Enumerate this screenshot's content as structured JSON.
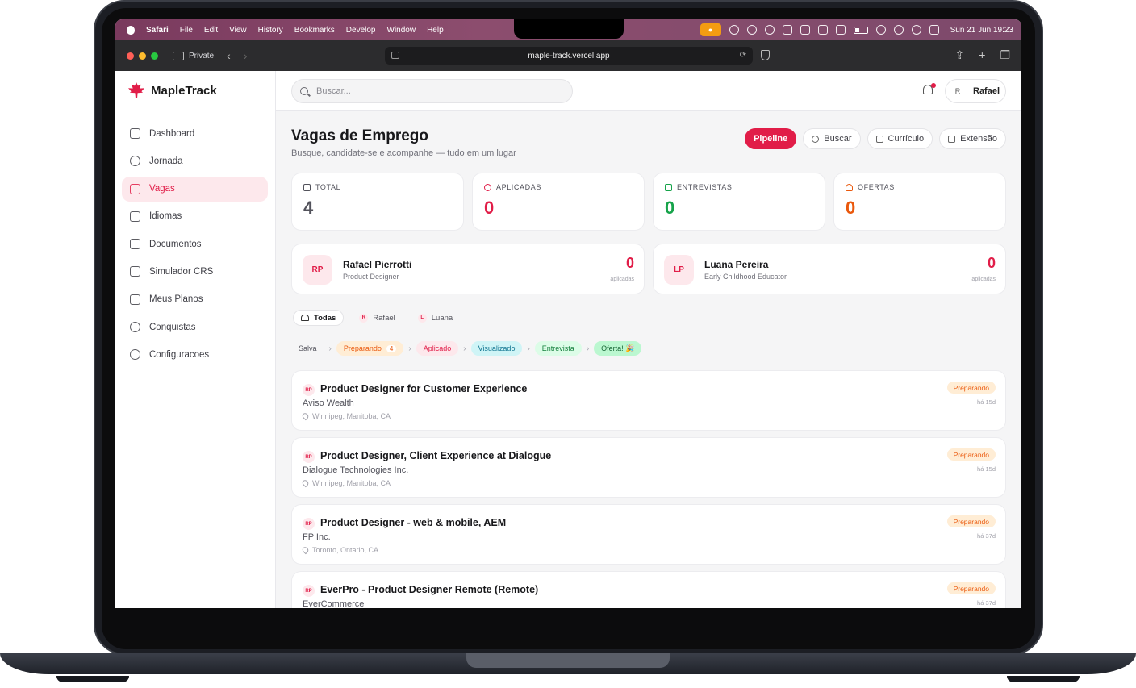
{
  "menubar": {
    "app": "Safari",
    "items": [
      "File",
      "Edit",
      "View",
      "History",
      "Bookmarks",
      "Develop",
      "Window",
      "Help"
    ],
    "clock": "Sun 21 Jun  19:23"
  },
  "browser": {
    "private_label": "Private",
    "url": "maple-track.vercel.app"
  },
  "brand": {
    "name": "MapleTrack",
    "color": "#e11d48"
  },
  "nav": {
    "items": [
      {
        "label": "Dashboard",
        "icon": "dashboard-icon"
      },
      {
        "label": "Jornada",
        "icon": "route-icon"
      },
      {
        "label": "Vagas",
        "icon": "briefcase-icon",
        "active": true
      },
      {
        "label": "Idiomas",
        "icon": "translate-icon"
      },
      {
        "label": "Documentos",
        "icon": "document-icon"
      },
      {
        "label": "Simulador CRS",
        "icon": "calculator-icon"
      },
      {
        "label": "Meus Planos",
        "icon": "map-icon"
      },
      {
        "label": "Conquistas",
        "icon": "trophy-icon"
      },
      {
        "label": "Configuracoes",
        "icon": "gear-icon"
      }
    ]
  },
  "topbar": {
    "search_placeholder": "Buscar...",
    "user_initial": "R",
    "user_name": "Rafael"
  },
  "page": {
    "title": "Vagas de Emprego",
    "subtitle": "Busque, candidate-se e acompanhe — tudo em um lugar",
    "actions": [
      "Pipeline",
      "Buscar",
      "Currículo",
      "Extensão"
    ]
  },
  "stats": [
    {
      "label": "TOTAL",
      "value": "4",
      "color": "#52525b"
    },
    {
      "label": "APLICADAS",
      "value": "0",
      "color": "#e11d48"
    },
    {
      "label": "ENTREVISTAS",
      "value": "0",
      "color": "#16a34a"
    },
    {
      "label": "OFERTAS",
      "value": "0",
      "color": "#ea580c"
    }
  ],
  "people": [
    {
      "initials": "RP",
      "name": "Rafael Pierrotti",
      "role": "Product Designer",
      "count": "0",
      "count_label": "aplicadas"
    },
    {
      "initials": "LP",
      "name": "Luana Pereira",
      "role": "Early Childhood Educator",
      "count": "0",
      "count_label": "aplicadas"
    }
  ],
  "filters": {
    "all": "Todas",
    "people": [
      {
        "initial": "R",
        "name": "Rafael"
      },
      {
        "initial": "L",
        "name": "Luana"
      }
    ]
  },
  "stages": [
    {
      "label": "Salva"
    },
    {
      "label": "Preparando",
      "count": "4",
      "bg": "#ffedd5",
      "fg": "#ea580c"
    },
    {
      "label": "Aplicado",
      "bg": "#fde8ec",
      "fg": "#e11d48"
    },
    {
      "label": "Visualizado",
      "bg": "#cff4f6",
      "fg": "#0e7490"
    },
    {
      "label": "Entrevista",
      "bg": "#dcfce7",
      "fg": "#15803d"
    },
    {
      "label": "Oferta! 🎉",
      "bg": "#bbf7d0",
      "fg": "#166534"
    }
  ],
  "jobs": [
    {
      "badge": "RP",
      "title": "Product Designer for Customer Experience",
      "company": "Aviso Wealth",
      "location": "Winnipeg, Manitoba, CA",
      "status": "Preparando",
      "age": "há 15d"
    },
    {
      "badge": "RP",
      "title": "Product Designer, Client Experience at Dialogue",
      "company": "Dialogue Technologies Inc.",
      "location": "Winnipeg, Manitoba, CA",
      "status": "Preparando",
      "age": "há 15d"
    },
    {
      "badge": "RP",
      "title": "Product Designer - web & mobile, AEM",
      "company": "FP Inc.",
      "location": "Toronto, Ontario, CA",
      "status": "Preparando",
      "age": "há 37d"
    },
    {
      "badge": "RP",
      "title": "EverPro - Product Designer Remote (Remote)",
      "company": "EverCommerce",
      "location": "",
      "status": "Preparando",
      "age": "há 37d"
    }
  ]
}
